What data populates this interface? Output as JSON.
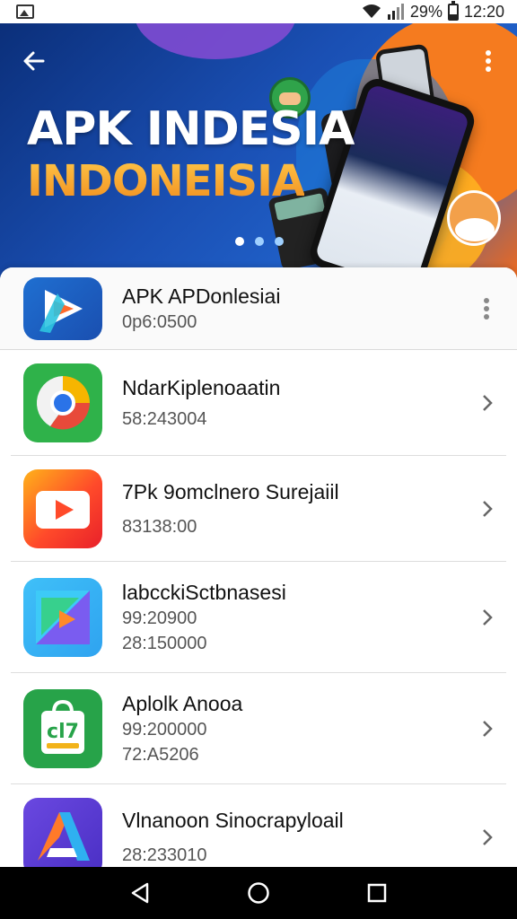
{
  "status_bar": {
    "battery_percent": "29%",
    "time": "12:20"
  },
  "hero": {
    "title": "APK INDESIA",
    "subtitle": "INDONEISIA",
    "carousel_active_index": 0,
    "carousel_count": 3
  },
  "featured_app": {
    "name": "APK APDonlesiai",
    "meta": "0p6:0500",
    "icon": "play-triangle-icon",
    "icon_colors": [
      "#1f6fd1",
      "#ff6a2b"
    ]
  },
  "apps": [
    {
      "name": "NdarKiplenoaatin",
      "meta": [
        "58:243004"
      ],
      "icon": "chrome-like-icon",
      "icon_colors": [
        "#2fb24a",
        "#f7b500",
        "#2a73e8"
      ]
    },
    {
      "name": "7Pk 9omclnero Surejaiil",
      "meta": [
        "83138:00"
      ],
      "icon": "video-play-icon",
      "icon_colors": [
        "#ff4a2a",
        "#ffb21a"
      ]
    },
    {
      "name": "labcckiSctbnasesi",
      "meta": [
        "99:20900",
        "28:150000"
      ],
      "icon": "prism-play-icon",
      "icon_colors": [
        "#2fa3f0",
        "#7a5cf0",
        "#ff8a2a"
      ]
    },
    {
      "name": "Aplolk Anooa",
      "meta": [
        "99:200000",
        "72:A5206"
      ],
      "icon": "shopping-bag-icon",
      "icon_colors": [
        "#27a349",
        "#ffffff"
      ]
    },
    {
      "name": "Vlnanoon Sinocrapyloail",
      "meta": [
        "28:233010"
      ],
      "icon": "a-letter-icon",
      "icon_colors": [
        "#5a3bd6",
        "#ff7a2a",
        "#2fb0f0"
      ]
    }
  ]
}
